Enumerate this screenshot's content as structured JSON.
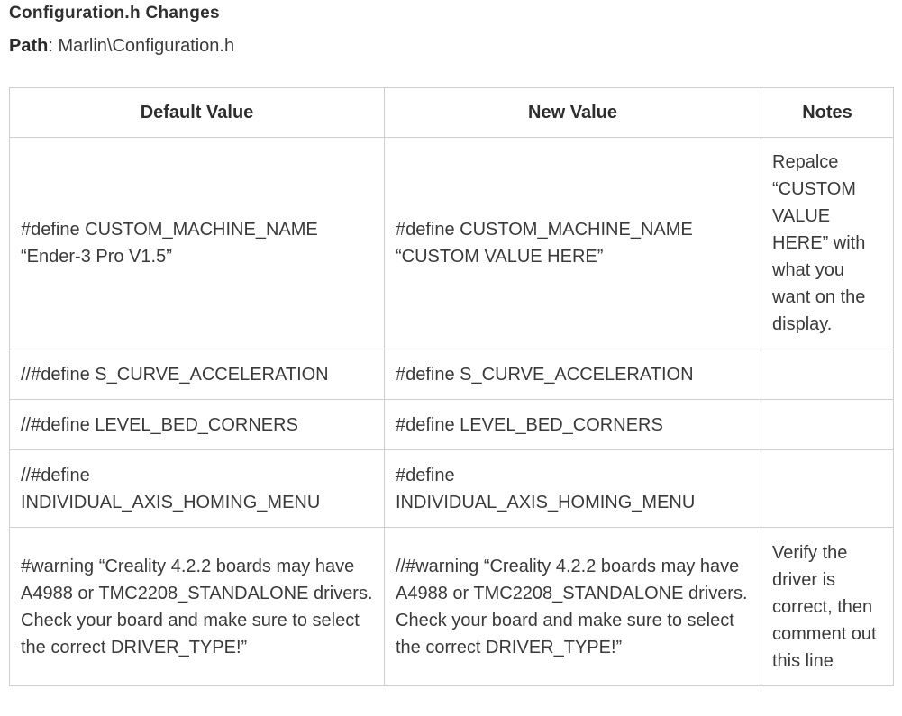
{
  "section": {
    "title": "Configuration.h Changes",
    "path_label": "Path",
    "path_value": ": Marlin\\Configuration.h"
  },
  "table": {
    "headers": [
      "Default Value",
      "New Value",
      "Notes"
    ],
    "rows": [
      {
        "default": "#define CUSTOM_MACHINE_NAME “Ender-3 Pro V1.5”",
        "new": "#define CUSTOM_MACHINE_NAME “CUSTOM VALUE HERE”",
        "notes": "Repalce “CUSTOM VALUE HERE” with what you want on the display."
      },
      {
        "default": "//#define S_CURVE_ACCELERATION",
        "new": "#define S_CURVE_ACCELERATION",
        "notes": ""
      },
      {
        "default": "//#define LEVEL_BED_CORNERS",
        "new": "#define LEVEL_BED_CORNERS",
        "notes": ""
      },
      {
        "default": "//#define INDIVIDUAL_AXIS_HOMING_MENU",
        "new": "#define INDIVIDUAL_AXIS_HOMING_MENU",
        "notes": ""
      },
      {
        "default": "#warning “Creality 4.2.2 boards may have A4988 or TMC2208_STANDALONE drivers. Check your board and make sure to select the correct DRIVER_TYPE!”",
        "new": "//#warning “Creality 4.2.2 boards may have A4988 or TMC2208_STANDALONE drivers. Check your board and make sure to select the correct DRIVER_TYPE!”",
        "notes": "Verify the driver is correct, then comment out this line"
      }
    ]
  }
}
